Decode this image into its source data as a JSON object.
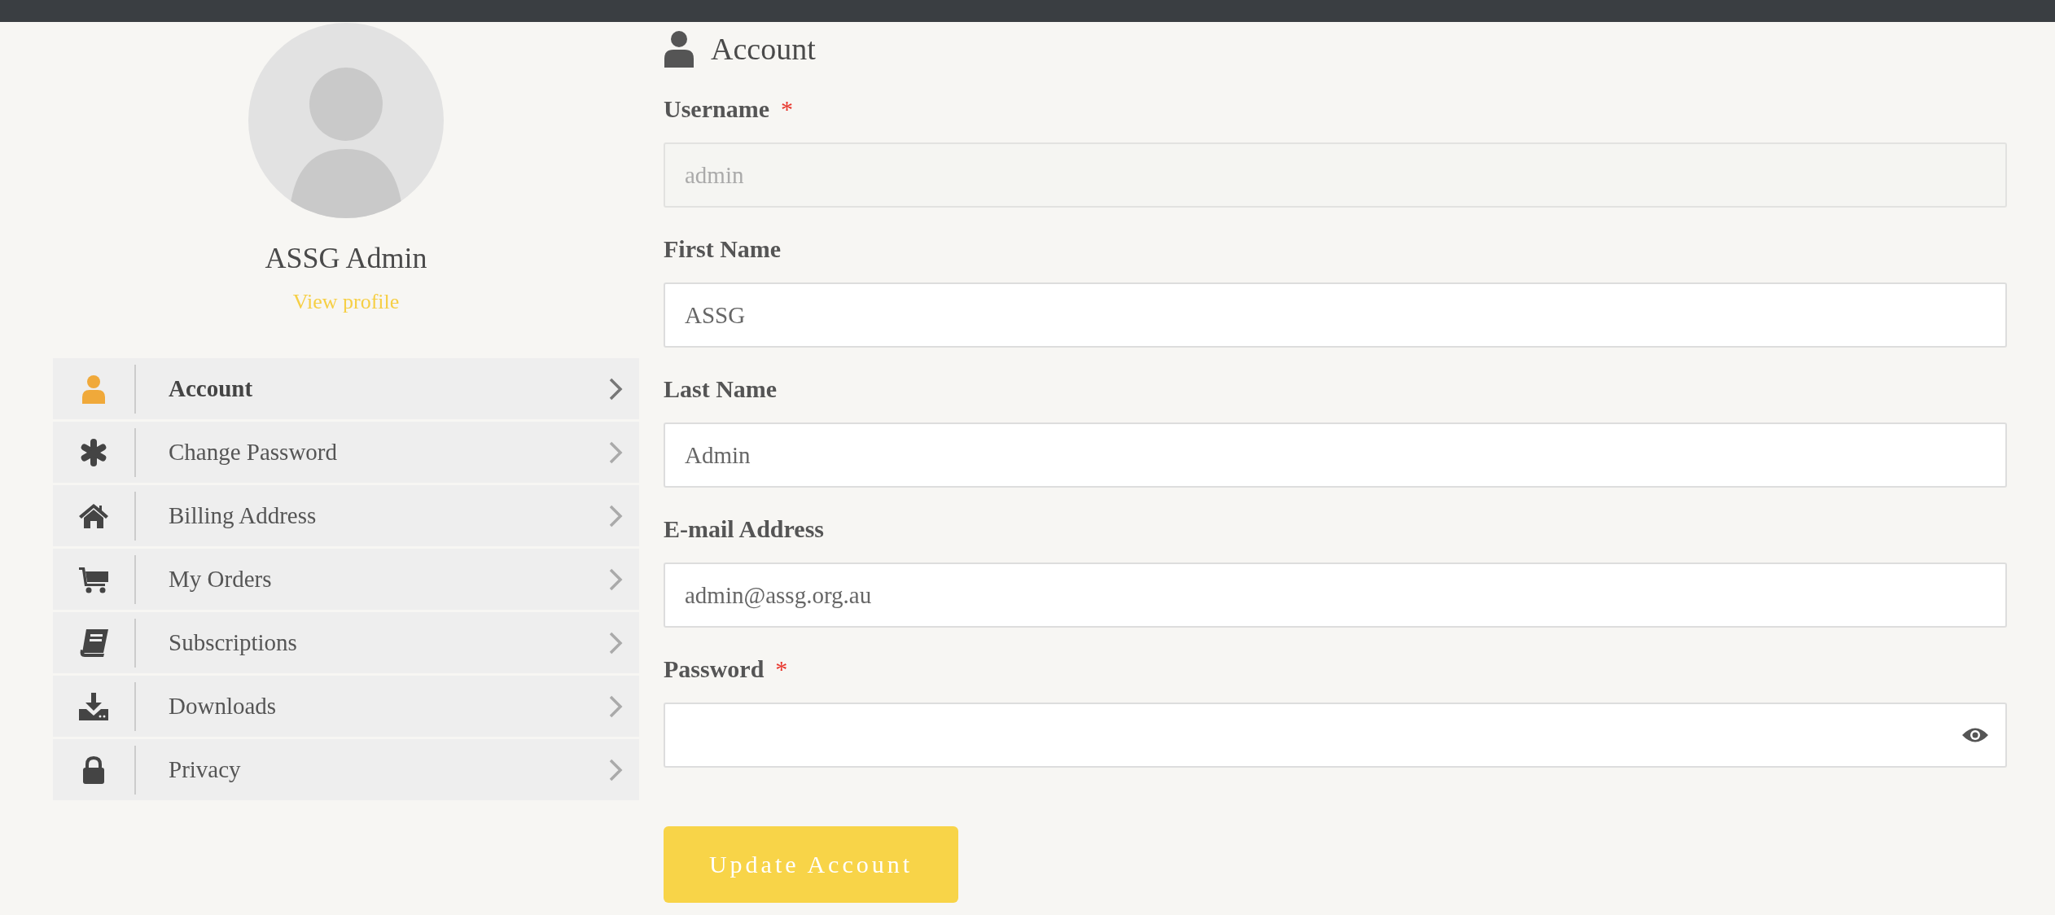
{
  "profile": {
    "name": "ASSG Admin",
    "link": "View profile"
  },
  "menu": [
    {
      "label": "Account",
      "selected": true
    },
    {
      "label": "Change Password",
      "selected": false
    },
    {
      "label": "Billing Address",
      "selected": false
    },
    {
      "label": "My Orders",
      "selected": false
    },
    {
      "label": "Subscriptions",
      "selected": false
    },
    {
      "label": "Downloads",
      "selected": false
    },
    {
      "label": "Privacy",
      "selected": false
    }
  ],
  "heading": "Account",
  "fields": [
    {
      "label": "Username",
      "required_mark": "*",
      "value": "admin",
      "disabled": true,
      "kind": "text"
    },
    {
      "label": "First Name",
      "value": "ASSG",
      "disabled": false,
      "kind": "text"
    },
    {
      "label": "Last Name",
      "value": "Admin",
      "disabled": false,
      "kind": "text"
    },
    {
      "label": "E-mail Address",
      "value": "admin@assg.org.au",
      "disabled": false,
      "kind": "text"
    },
    {
      "label": "Password",
      "required_mark": "*",
      "disabled": false,
      "kind": "password"
    }
  ],
  "submit": "Update Account"
}
